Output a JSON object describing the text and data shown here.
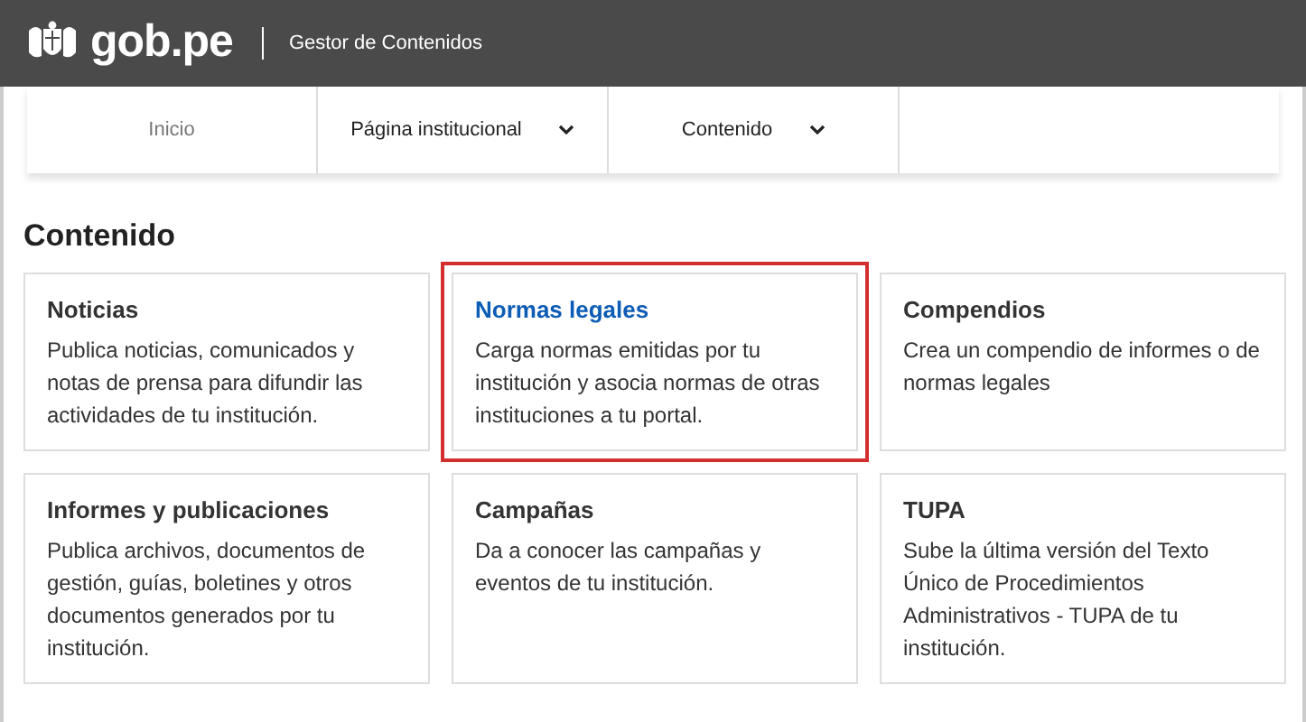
{
  "header": {
    "logo": "gob.pe",
    "subtitle": "Gestor de Contenidos"
  },
  "nav": [
    {
      "label": "Inicio",
      "dropdown": false
    },
    {
      "label": "Página institucional",
      "dropdown": true
    },
    {
      "label": "Contenido",
      "dropdown": true
    }
  ],
  "heading": "Contenido",
  "cards": [
    {
      "title": "Noticias",
      "text": "Publica noticias, comunicados y notas de prensa para difundir las actividades de tu institución.",
      "selected": false
    },
    {
      "title": "Normas legales",
      "text": "Carga normas emitidas por tu institución y asocia normas de otras instituciones a tu portal.",
      "selected": true
    },
    {
      "title": "Compendios",
      "text": "Crea un compendio de informes o de normas legales",
      "selected": false
    },
    {
      "title": "Informes y publicaciones",
      "text": "Publica archivos, documentos de gestión, guías, boletines y otros documentos generados por tu institución.",
      "selected": false
    },
    {
      "title": "Campañas",
      "text": "Da a conocer las campañas y eventos de tu institución.",
      "selected": false
    },
    {
      "title": "TUPA",
      "text": "Sube la última versión del Texto Único de Procedimientos Administrativos - TUPA de tu institución.",
      "selected": false
    }
  ]
}
